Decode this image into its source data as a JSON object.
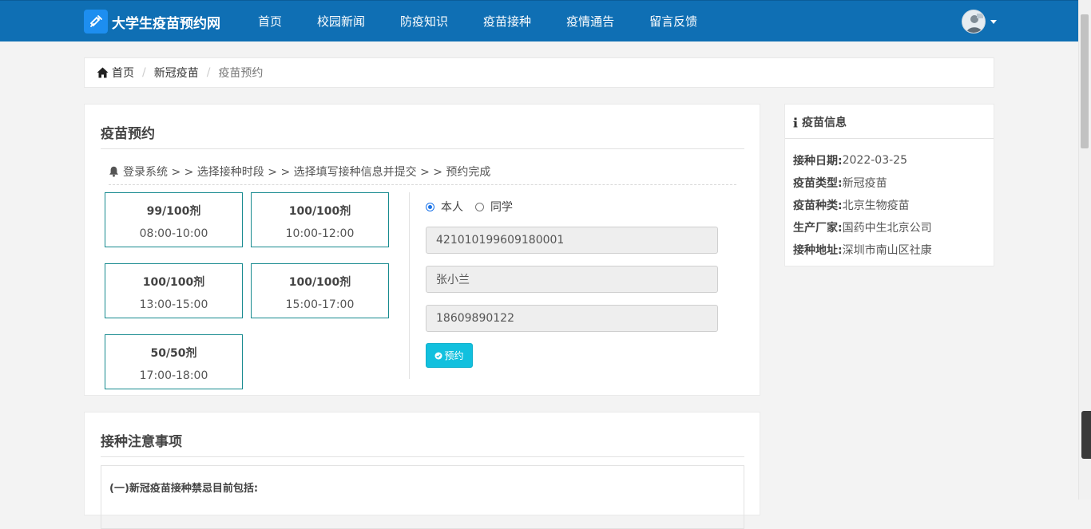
{
  "header": {
    "brand": "大学生疫苗预约网",
    "nav": [
      "首页",
      "校园新闻",
      "防疫知识",
      "疫苗接种",
      "疫情通告",
      "留言反馈"
    ]
  },
  "breadcrumb": {
    "home": "首页",
    "category": "新冠疫苗",
    "current": "疫苗预约",
    "separator": "/"
  },
  "booking": {
    "title": "疫苗预约",
    "steps": "登录系统 > > 选择接种时段 > > 选择填写接种信息并提交 > > 预约完成",
    "slots": [
      {
        "count": "99/100剂",
        "time": "08:00-10:00"
      },
      {
        "count": "100/100剂",
        "time": "10:00-12:00"
      },
      {
        "count": "100/100剂",
        "time": "13:00-15:00"
      },
      {
        "count": "100/100剂",
        "time": "15:00-17:00"
      },
      {
        "count": "50/50剂",
        "time": "17:00-18:00"
      }
    ],
    "radio": {
      "self": "本人",
      "classmate": "同学",
      "selected": "self"
    },
    "fields": {
      "id_number": "421010199609180001",
      "name": "张小兰",
      "phone": "18609890122"
    },
    "submit_label": "预约"
  },
  "notes": {
    "title": "接种注意事项",
    "first_line": "(一)新冠疫苗接种禁忌目前包括:"
  },
  "info": {
    "title": "疫苗信息",
    "rows": [
      {
        "label": "接种日期:",
        "value": "2022-03-25"
      },
      {
        "label": "疫苗类型:",
        "value": "新冠疫苗"
      },
      {
        "label": "疫苗种类:",
        "value": "北京生物疫苗"
      },
      {
        "label": "生产厂家:",
        "value": "国药中生北京公司"
      },
      {
        "label": "接种地址:",
        "value": "深圳市南山区社康"
      }
    ]
  },
  "colors": {
    "header_bg": "#0f6fb4",
    "slot_border": "#178a8f",
    "submit_bg": "#12c0de",
    "radio_accent": "#1a73e8"
  }
}
